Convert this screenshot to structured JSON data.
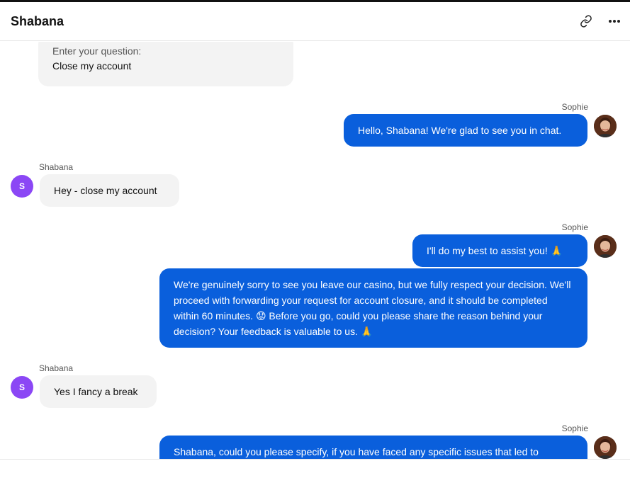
{
  "header": {
    "title": "Shabana",
    "link_icon": "link-icon",
    "more_icon": "more-dots-icon"
  },
  "form": {
    "label": "Enter your question:",
    "value": "Close my account"
  },
  "messages": [
    {
      "sender": "Sophie",
      "text": "Hello, Shabana! We're glad to see you in chat."
    },
    {
      "sender": "Shabana",
      "avatar_letter": "S",
      "text": "Hey - close my account"
    },
    {
      "sender": "Sophie",
      "text": "I'll do my best to assist you! 🙏"
    },
    {
      "text": "We're genuinely sorry to see you leave our casino, but we fully respect your decision. We'll proceed with forwarding your request for account closure, and it should be completed within 60 minutes. 😟 Before you go, could you please share the reason behind your decision? Your feedback is valuable to us. 🙏"
    },
    {
      "sender": "Shabana",
      "avatar_letter": "S",
      "text": "Yes I fancy a break"
    },
    {
      "sender": "Sophie",
      "text": "Shabana, could you please specify, if you have faced any specific issues that led to"
    }
  ],
  "colors": {
    "agent_bubble": "#0a5fdc",
    "user_bubble": "#f3f3f3",
    "user_avatar": "#8b47f5"
  }
}
